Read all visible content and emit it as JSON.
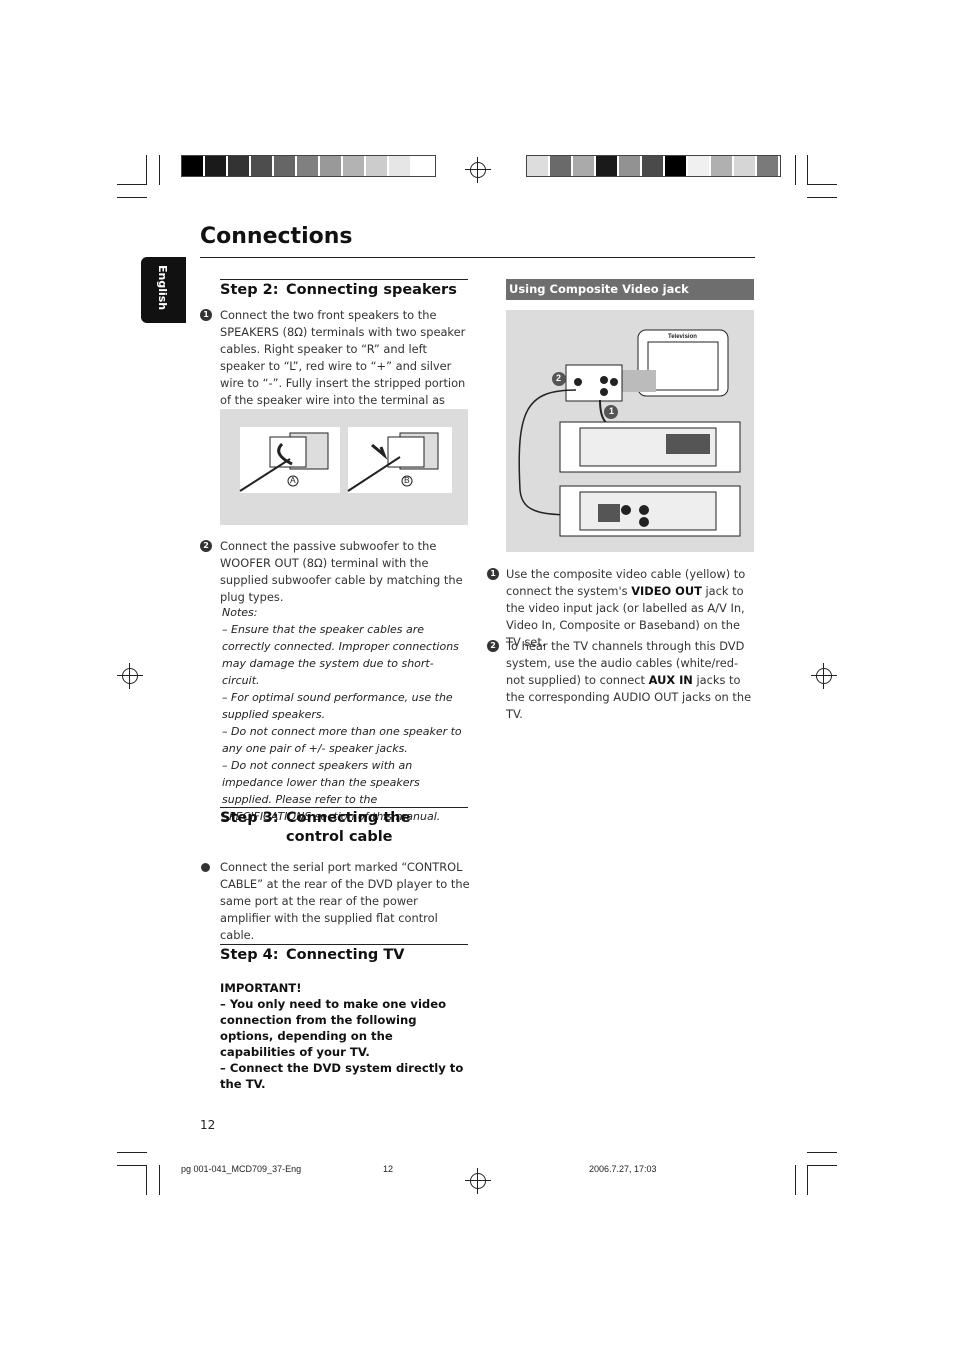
{
  "header": {
    "title": "Connections",
    "side_tab": "English"
  },
  "calibration": {
    "left_bar": [
      "#000000",
      "#1a1a1a",
      "#333333",
      "#4d4d4d",
      "#666666",
      "#808080",
      "#999999",
      "#b3b3b3",
      "#cccccc",
      "#e6e6e6",
      "#ffffff"
    ],
    "right_bar": [
      "#dddddd",
      "#6a6a6a",
      "#aaaaaa",
      "#1a1a1a",
      "#929292",
      "#4a4a4a",
      "#000000",
      "#f0f0f0",
      "#b0b0b0",
      "#d6d6d6",
      "#7a7a7a"
    ]
  },
  "step2": {
    "num": "Step 2:",
    "title": "Connecting speakers",
    "item1": "Connect the two front speakers to the SPEAKERS (8Ω) terminals with two speaker cables. Right speaker to “R” and left speaker to “L”, red wire to “+” and silver wire to “-”. Fully insert the stripped portion of the speaker wire into the terminal as shown.",
    "label_a": "A",
    "label_b": "B",
    "item2": "Connect the passive subwoofer to the WOOFER OUT (8Ω) terminal with the supplied subwoofer cable by matching the plug types.",
    "notes_title": "Notes:",
    "notes": [
      "–   Ensure that the speaker cables are correctly connected. Improper connections may damage the system due to short-circuit.",
      "–   For optimal sound performance, use the supplied speakers.",
      "–   Do not connect more than one speaker to any one pair of +/- speaker jacks.",
      "–   Do not connect speakers with an impedance lower than the speakers supplied. Please refer to the SPECIFICATIONS section of this manual."
    ]
  },
  "step3": {
    "num": "Step 3:",
    "title": "Connecting the control cable",
    "item": "Connect the serial port marked “CONTROL CABLE” at the rear of the DVD player to the same port at the rear of the power amplifier with the supplied flat control cable."
  },
  "step4": {
    "num": "Step 4:",
    "title": "Connecting TV",
    "important": "IMPORTANT!",
    "lines": [
      "–   You only need to make one video connection from the following options, depending on the capabilities of your TV.",
      "–   Connect the DVD system directly to the TV."
    ]
  },
  "composite": {
    "heading": "Using Composite Video jack",
    "tv_label": "Television",
    "callout1": "1",
    "callout2": "2",
    "item1_pre": "Use the composite video cable (yellow) to connect the system's ",
    "item1_bold": "VIDEO OUT",
    "item1_post": " jack to the video input jack (or labelled as A/V In, Video In, Composite or Baseband) on the TV set.",
    "item2_pre": "To hear the TV channels through this DVD system, use the audio cables (white/red-not supplied) to connect ",
    "item2_bold": "AUX IN",
    "item2_post": " jacks to the corresponding AUDIO OUT jacks on the TV."
  },
  "footer": {
    "page_number": "12",
    "file": "pg 001-041_MCD709_37-Eng",
    "sheet": "12",
    "date": "2006.7.27, 17:03"
  }
}
